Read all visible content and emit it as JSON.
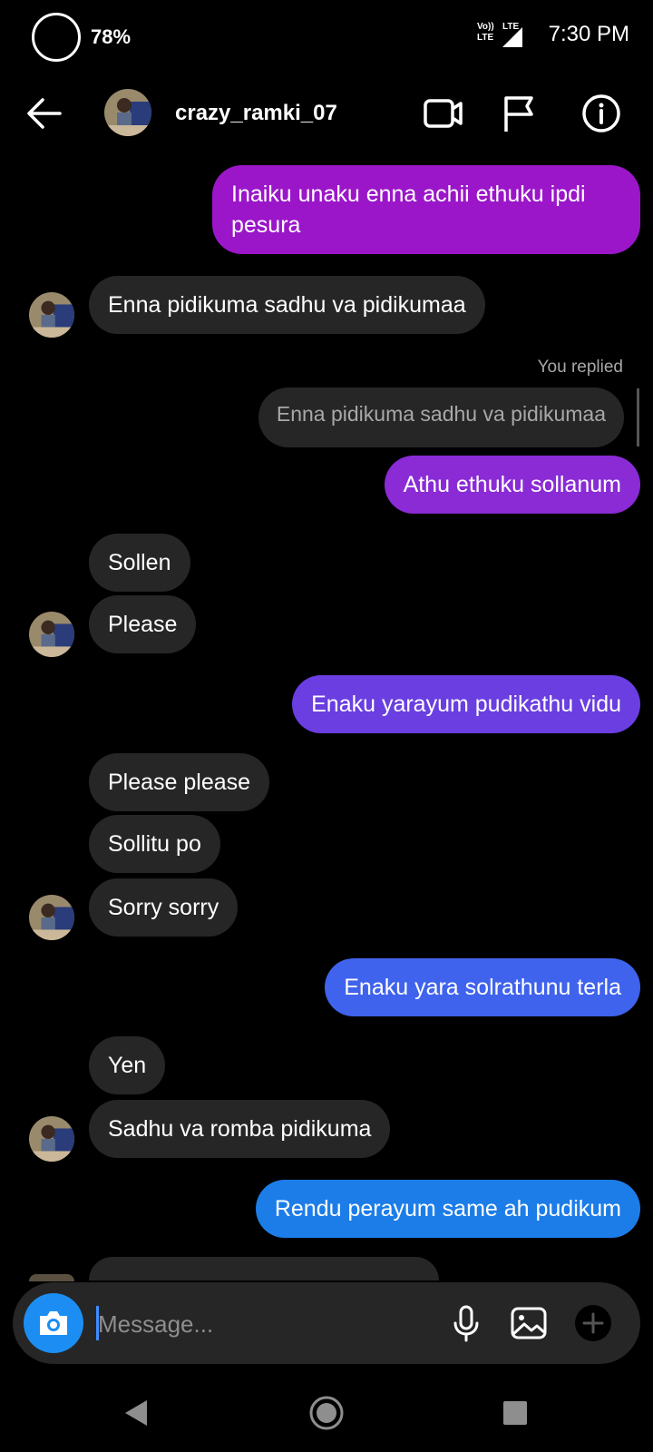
{
  "status_bar": {
    "battery": "78%",
    "network": "Vo)) LTE",
    "lte": "LTE",
    "time": "7:30 PM"
  },
  "header": {
    "username": "crazy_ramki_07",
    "icons": [
      "back-arrow-icon",
      "video-call-icon",
      "flag-icon",
      "info-icon"
    ]
  },
  "messages": [
    {
      "from": "me",
      "text": "Inaiku unaku enna achii ethuku ipdi pesura",
      "color": "#9b16c9"
    },
    {
      "from": "them",
      "text": "Enna pidikuma sadhu va pidikumaa"
    },
    {
      "from": "me",
      "text": "Athu ethuku sollanum",
      "color": "#8a2bd6",
      "reply_label": "You replied",
      "quoted": "Enna pidikuma sadhu va pidikumaa"
    },
    {
      "from": "them",
      "text": "Sollen"
    },
    {
      "from": "them",
      "text": "Please"
    },
    {
      "from": "me",
      "text": "Enaku yarayum pudikathu vidu",
      "color": "#6a3ee0"
    },
    {
      "from": "them",
      "text": "Please please"
    },
    {
      "from": "them",
      "text": "Sollitu po"
    },
    {
      "from": "them",
      "text": "Sorry sorry"
    },
    {
      "from": "me",
      "text": "Enaku yara solrathunu terla",
      "color": "#3f63ec"
    },
    {
      "from": "them",
      "text": "Yen"
    },
    {
      "from": "them",
      "text": "Sadhu va romba pidikuma"
    },
    {
      "from": "me",
      "text": "Rendu perayum same ah pudikum",
      "color": "#1c7de9"
    }
  ],
  "composer": {
    "placeholder": "Message..."
  },
  "colors": {
    "background": "#000000",
    "their_bubble": "#262626",
    "camera_button": "#1c8ef3"
  }
}
